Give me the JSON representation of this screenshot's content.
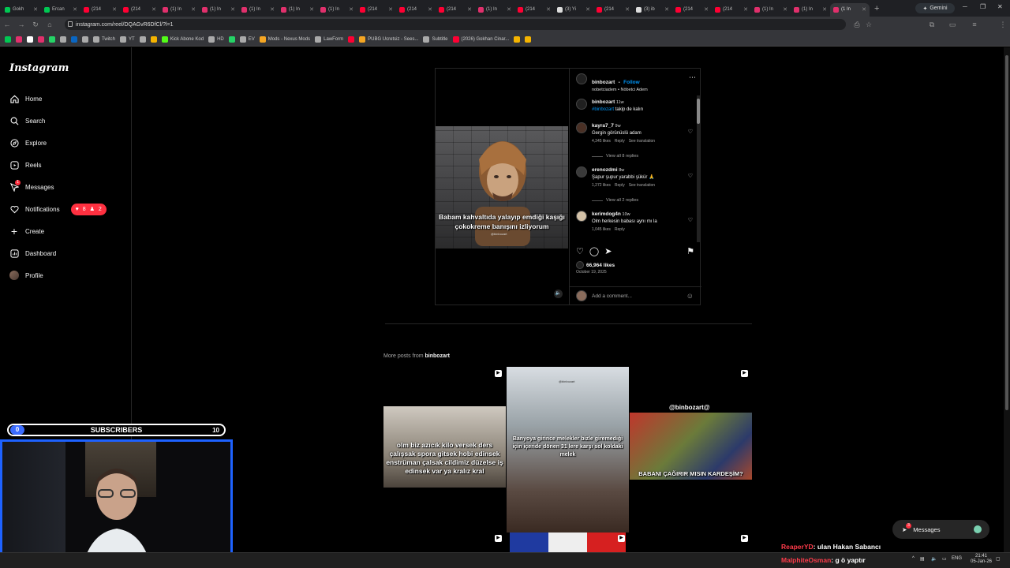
{
  "browser": {
    "tabs": [
      {
        "label": "Gokh",
        "color": "#00c853"
      },
      {
        "label": "Ercan",
        "color": "#00c853"
      },
      {
        "label": "(214",
        "color": "#ff0033"
      },
      {
        "label": "(214",
        "color": "#ff0033"
      },
      {
        "label": "(1) In",
        "color": "#e1306c"
      },
      {
        "label": "(1) In",
        "color": "#e1306c"
      },
      {
        "label": "(1) In",
        "color": "#e1306c"
      },
      {
        "label": "(1) In",
        "color": "#e1306c"
      },
      {
        "label": "(1) In",
        "color": "#e1306c"
      },
      {
        "label": "(214",
        "color": "#ff0033"
      },
      {
        "label": "(214",
        "color": "#ff0033"
      },
      {
        "label": "(214",
        "color": "#ff0033"
      },
      {
        "label": "(1) In",
        "color": "#e1306c"
      },
      {
        "label": "(214",
        "color": "#ff0033"
      },
      {
        "label": "(3) Yi",
        "color": "#dddddd"
      },
      {
        "label": "(214",
        "color": "#ff0033"
      },
      {
        "label": "(3) ib",
        "color": "#dddddd"
      },
      {
        "label": "(214",
        "color": "#ff0033"
      },
      {
        "label": "(214",
        "color": "#ff0033"
      },
      {
        "label": "(1) In",
        "color": "#e1306c"
      },
      {
        "label": "(1) In",
        "color": "#e1306c"
      },
      {
        "label": "(1 In",
        "color": "#e1306c"
      }
    ],
    "gemini_label": "Gemini",
    "url": "instagram.com/reel/DQAGvR6DfCl/?l=1",
    "bookmarks": [
      {
        "label": "",
        "color": "#00c853"
      },
      {
        "label": "",
        "color": "#e1306c"
      },
      {
        "label": "",
        "color": "#ffffff"
      },
      {
        "label": "",
        "color": "#e1306c"
      },
      {
        "label": "",
        "color": "#25d366"
      },
      {
        "label": "",
        "color": "#aaaaaa"
      },
      {
        "label": "",
        "color": "#0a66c2"
      },
      {
        "label": "",
        "color": "#aaaaaa"
      },
      {
        "label": "Twitch",
        "color": "#aaaaaa"
      },
      {
        "label": "YT",
        "color": "#aaaaaa"
      },
      {
        "label": "",
        "color": "#aaaaaa"
      },
      {
        "label": "",
        "color": "#f5b400"
      },
      {
        "label": "Kick Abone Kod",
        "color": "#53fc18"
      },
      {
        "label": "HD",
        "color": "#aaaaaa"
      },
      {
        "label": "",
        "color": "#25d366"
      },
      {
        "label": "EV",
        "color": "#aaaaaa"
      },
      {
        "label": "Mods - Nexus Mods",
        "color": "#f5a623"
      },
      {
        "label": "LawForm",
        "color": "#aaaaaa"
      },
      {
        "label": "",
        "color": "#ff0033"
      },
      {
        "label": "PUBG Ucretsiz - Sees...",
        "color": "#f5a623"
      },
      {
        "label": "Subtitle",
        "color": "#aaaaaa"
      },
      {
        "label": "(2026) Gokhan Cinar...",
        "color": "#ff0033"
      },
      {
        "label": "",
        "color": "#f5b400"
      },
      {
        "label": "",
        "color": "#f5b400"
      }
    ]
  },
  "sidebar": {
    "logo": "Instagram",
    "items": [
      {
        "label": "Home",
        "icon": "home-icon"
      },
      {
        "label": "Search",
        "icon": "search-icon"
      },
      {
        "label": "Explore",
        "icon": "compass-icon"
      },
      {
        "label": "Reels",
        "icon": "reels-icon"
      },
      {
        "label": "Messages",
        "icon": "messenger-icon",
        "badge": "1"
      },
      {
        "label": "Notifications",
        "icon": "heart-icon"
      },
      {
        "label": "Create",
        "icon": "plus-icon"
      },
      {
        "label": "Dashboard",
        "icon": "dashboard-icon"
      },
      {
        "label": "Profile",
        "icon": "avatar"
      }
    ],
    "notif_likes": "8",
    "notif_follows": "2"
  },
  "post": {
    "author": "binbozart",
    "follow": "Follow",
    "dot": "•",
    "audio": "nobetciadem • Nöbetci Adem",
    "video_caption": "Babam kahvaltıda yalayıp emdiği kaşığı çokokreme banışını izliyorum",
    "video_watermark": "@binbozart",
    "caption_user": "binbozart",
    "caption_time": "11w",
    "caption_tag": "#binbozart",
    "caption_text": " takip de kalın",
    "comments": [
      {
        "user": "kayra7_7",
        "time": "9w",
        "text": "Gergin görünüslü adam",
        "likes": "4,345 likes",
        "reply": "Reply",
        "translate": "See translation",
        "view_replies": "View all 8 replies"
      },
      {
        "user": "erenozdmi",
        "time": "8w",
        "text": "Şapur şupur yarabbi şükür 🙏",
        "likes": "1,272 likes",
        "reply": "Reply",
        "translate": "See translation",
        "view_replies": "View all 2 replies"
      },
      {
        "user": "kerimdog4n",
        "time": "10w",
        "text": "Olm herkesin babası aynı mı la",
        "likes": "1,045 likes",
        "reply": "Reply",
        "translate": "",
        "view_replies": ""
      }
    ],
    "likes": "66,964 likes",
    "date": "October 19, 2025",
    "add_comment_placeholder": "Add a comment..."
  },
  "more_posts": {
    "prefix": "More posts from ",
    "user": "binbozart",
    "items": [
      {
        "text": "olm biz azıcık kilo versek ders çalışsak spora gitsek hobi edinsek enstrüman çalsak cildimiz düzelse iş edinsek var ya kralız kral"
      },
      {
        "text": "Banyoya girince melekler bizle giremediği için içeride dönen 31 lere karşı sol koldaki melek",
        "watermark": "@binbozart"
      },
      {
        "text": "BABANI ÇAĞIRIR MISIN KARDEŞİM?",
        "watermark": "@binbozart@"
      }
    ]
  },
  "overlay": {
    "sub_left": "0",
    "sub_label": "SUBSCRIBERS",
    "sub_right": "10",
    "messages_label": "Messages",
    "messages_badge": "3",
    "chat": [
      {
        "name": "ReaperYD",
        "msg": ": ulan Hakan Sabancı"
      },
      {
        "name": "MalphiteOsman",
        "msg": ": g ö yaptır"
      }
    ]
  },
  "taskbar": {
    "lang": "ENG",
    "time": "21:41",
    "date": "05-Jan-26"
  }
}
